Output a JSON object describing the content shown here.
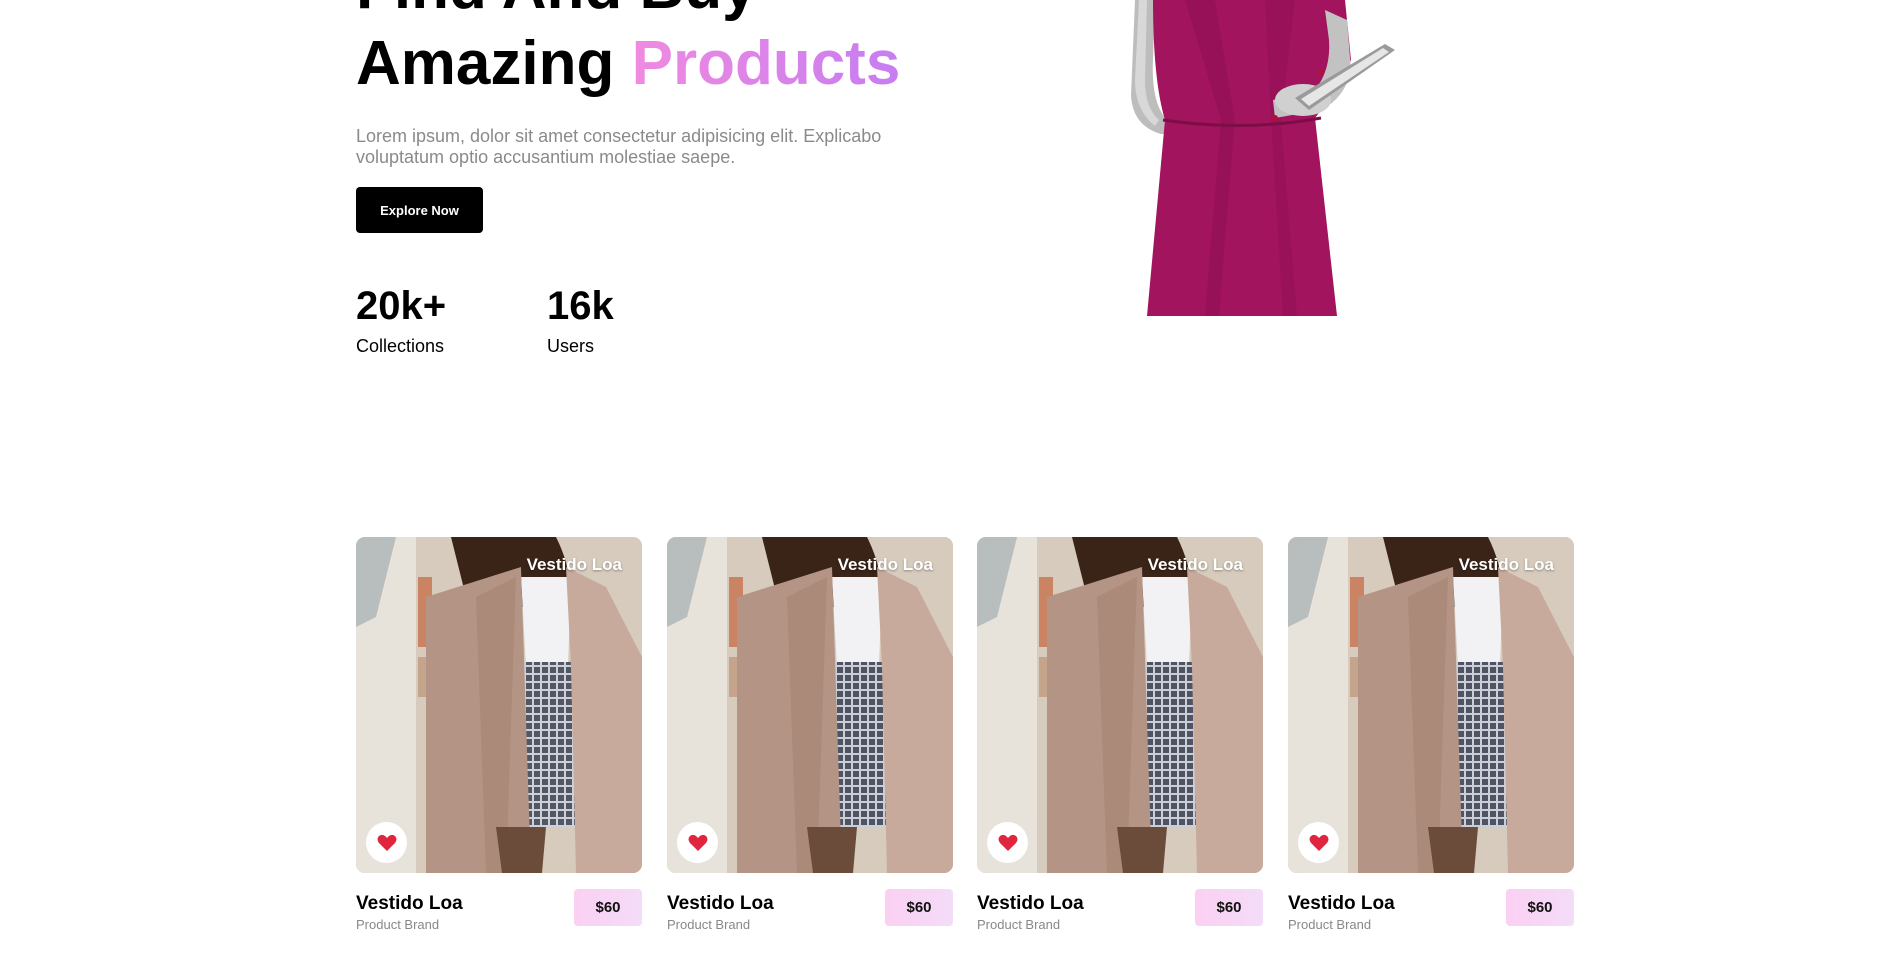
{
  "hero": {
    "title_line1": "Find And Buy",
    "title_line2_prefix": "Amazing ",
    "title_line2_accent": "Products",
    "description": "Lorem ipsum, dolor sit amet consectetur adipisicing elit. Explicabo voluptatum optio accusantium molestiae saepe.",
    "cta_label": "Explore Now",
    "stats": [
      {
        "value": "20k+",
        "label": "Collections"
      },
      {
        "value": "16k",
        "label": "Users"
      }
    ]
  },
  "products": [
    {
      "image_label": "Vestido Loa",
      "name": "Vestido Loa",
      "brand": "Product Brand",
      "price": "$60"
    },
    {
      "image_label": "Vestido Loa",
      "name": "Vestido Loa",
      "brand": "Product Brand",
      "price": "$60"
    },
    {
      "image_label": "Vestido Loa",
      "name": "Vestido Loa",
      "brand": "Product Brand",
      "price": "$60"
    },
    {
      "image_label": "Vestido Loa",
      "name": "Vestido Loa",
      "brand": "Product Brand",
      "price": "$60"
    }
  ],
  "colors": {
    "accent_gradient": [
      "#f08ae0",
      "#c77df2"
    ],
    "dress": "#a3145f",
    "heart": "#e0263e",
    "price_badge": "#fbd0f2"
  },
  "icons": [
    "heart-icon"
  ]
}
